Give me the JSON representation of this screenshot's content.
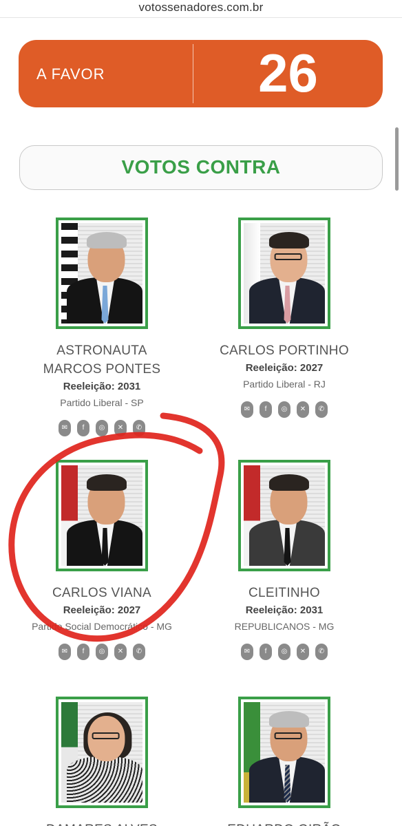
{
  "browser": {
    "url": "votossenadores.com.br"
  },
  "tally": {
    "label": "A FAVOR",
    "count": "26"
  },
  "section": {
    "title": "VOTOS CONTRA"
  },
  "senators": [
    {
      "name": "ASTRONAUTA MARCOS PONTES",
      "reelection": "Reeleição: 2031",
      "party": "Partido Liberal - SP"
    },
    {
      "name": "CARLOS PORTINHO",
      "reelection": "Reeleição: 2027",
      "party": "Partido Liberal - RJ"
    },
    {
      "name": "CARLOS VIANA",
      "reelection": "Reeleição: 2027",
      "party": "Partido Social Democrático - MG"
    },
    {
      "name": "CLEITINHO",
      "reelection": "Reeleição: 2031",
      "party": "REPUBLICANOS - MG"
    },
    {
      "name": "DAMARES ALVES"
    },
    {
      "name": "EDUARDO GIRÃO"
    }
  ],
  "social_icons": [
    "mail-icon",
    "facebook-icon",
    "instagram-icon",
    "x-icon",
    "phone-icon"
  ],
  "colors": {
    "accent_orange": "#df5c27",
    "accent_green": "#3a9f48",
    "annotation_red": "#e0241c"
  }
}
